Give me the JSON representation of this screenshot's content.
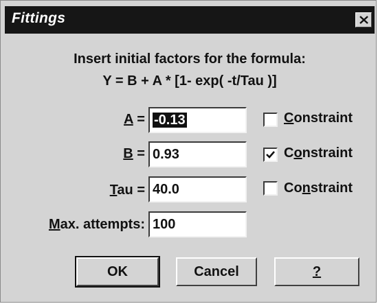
{
  "window": {
    "title": "Fittings",
    "close_glyph": "close-icon"
  },
  "instructions": {
    "line1": "Insert initial factors for the formula:",
    "line2": "Y = B + A * [1- exp( -t/Tau )]"
  },
  "fields": {
    "a": {
      "label_pre": "",
      "label_key": "A",
      "label_post": " =",
      "value": "-0.13",
      "selected": true
    },
    "b": {
      "label_pre": "",
      "label_key": "B",
      "label_post": " =",
      "value": "0.93"
    },
    "tau": {
      "label_pre": "",
      "label_key": "T",
      "label_post": "au =",
      "value": "40.0"
    },
    "max_attempts": {
      "label_pre": "",
      "label_key": "M",
      "label_post": "ax. attempts:",
      "value": "100"
    }
  },
  "constraints": {
    "a": {
      "pre": "",
      "key": "C",
      "post": "onstraint",
      "checked": false
    },
    "b": {
      "pre": "C",
      "key": "o",
      "post": "nstraint",
      "checked": true
    },
    "tau": {
      "pre": "Co",
      "key": "n",
      "post": "straint",
      "checked": false
    }
  },
  "buttons": {
    "ok": "OK",
    "cancel": "Cancel",
    "help": "?"
  }
}
